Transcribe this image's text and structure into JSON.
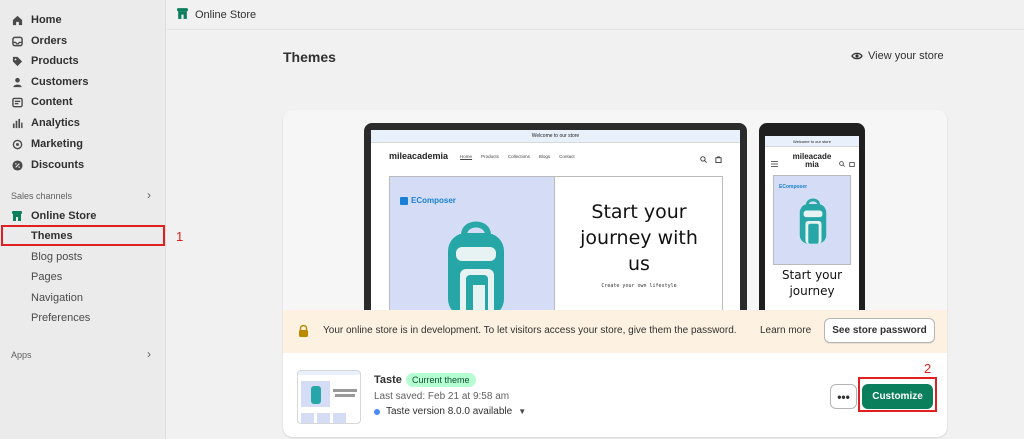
{
  "sidebar": {
    "items": [
      {
        "label": "Home",
        "icon": "home-icon"
      },
      {
        "label": "Orders",
        "icon": "inbox-icon"
      },
      {
        "label": "Products",
        "icon": "tag-icon"
      },
      {
        "label": "Customers",
        "icon": "person-icon"
      },
      {
        "label": "Content",
        "icon": "content-icon"
      },
      {
        "label": "Analytics",
        "icon": "bar-chart-icon"
      },
      {
        "label": "Marketing",
        "icon": "target-icon"
      },
      {
        "label": "Discounts",
        "icon": "discount-icon"
      }
    ],
    "sales_channels_label": "Sales channels",
    "online_store": {
      "label": "Online Store",
      "icon": "store-icon"
    },
    "sub_items": [
      {
        "label": "Themes",
        "active": true
      },
      {
        "label": "Blog posts"
      },
      {
        "label": "Pages"
      },
      {
        "label": "Navigation"
      },
      {
        "label": "Preferences"
      }
    ],
    "apps_label": "Apps"
  },
  "annotations": {
    "one": "1",
    "two": "2",
    "color": "#e02020"
  },
  "topbar": {
    "title": "Online Store"
  },
  "page": {
    "title": "Themes",
    "view_store": "View your store"
  },
  "preview": {
    "announcement": "Welcome to our store",
    "logo": "mileacademia",
    "nav": [
      "Home",
      "Products",
      "Collections",
      "Blogs",
      "Contact"
    ],
    "brand": "EComposer",
    "hero_lines": [
      "Start your",
      "journey with",
      "us"
    ],
    "hero_sub": "Create your own lifestyle",
    "phone_logo_lines": [
      "mileacade",
      "mia"
    ],
    "phone_hero_lines": [
      "Start your",
      "journey"
    ]
  },
  "banner": {
    "text": "Your online store is in development. To let visitors access your store, give them the password.",
    "learn_more": "Learn more",
    "button": "See store password"
  },
  "theme": {
    "name": "Taste",
    "badge": "Current theme",
    "last_saved": "Last saved: Feb 21 at 9:58 am",
    "version": "Taste version 8.0.0 available",
    "more": "•••",
    "customize": "Customize"
  },
  "colors": {
    "accent": "#0b7e5c",
    "badge_bg": "#b4fed2",
    "banner_bg": "#fdf2e1",
    "annotation": "#e02020"
  }
}
